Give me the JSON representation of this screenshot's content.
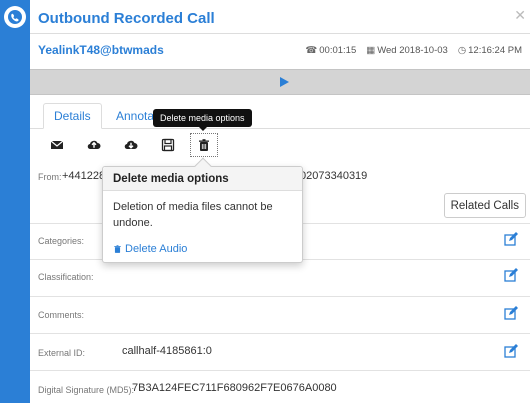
{
  "window": {
    "title": "Outbound Recorded Call",
    "close_icon": "close-icon"
  },
  "header": {
    "user": "YealinkT48@btwmads",
    "duration": "00:01:15",
    "date": "Wed 2018-10-03",
    "time": "12:16:24 PM"
  },
  "tabs": [
    {
      "label": "Details"
    },
    {
      "label": "Annotat"
    }
  ],
  "tooltip": "Delete media options",
  "toolbar": [
    "email-icon",
    "upload-icon",
    "download-icon",
    "save-icon",
    "trash-icon"
  ],
  "from": {
    "label": "From:",
    "value_left": "+441228",
    "value_right": "02073340319"
  },
  "related_calls": "Related Calls",
  "fields": {
    "categories": "Categories:",
    "classification": "Classification:",
    "comments": "Comments:",
    "external_id_label": "External ID:",
    "external_id_value": "callhalf-4185861:0",
    "signature_label": "Digital Signature (MD5):",
    "signature_value": "7B3A124FEC711F680962F7E0676A0080"
  },
  "popover": {
    "title": "Delete media options",
    "message": "Deletion of media files cannot be undone.",
    "action": "Delete Audio"
  },
  "colors": {
    "accent": "#2b7fd6",
    "player": "#d4d4d4"
  }
}
